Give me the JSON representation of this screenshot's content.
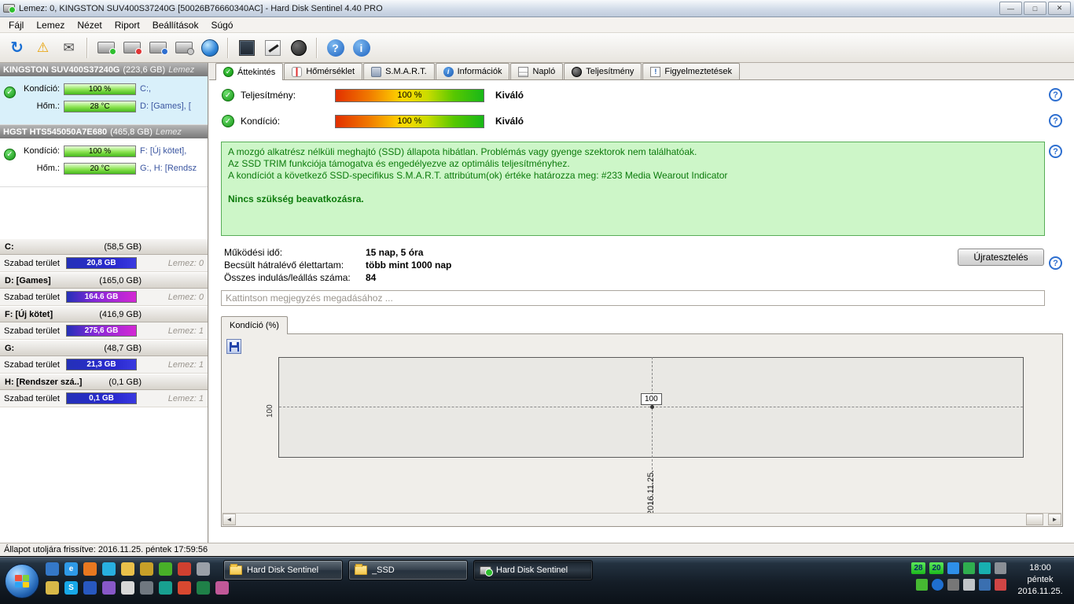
{
  "window": {
    "title": "Lemez: 0, KINGSTON SUV400S37240G [50026B76660340AC]  -  Hard Disk Sentinel 4.40 PRO",
    "controls": {
      "minimize": "—",
      "maximize": "□",
      "close": "✕"
    }
  },
  "icons": {
    "refresh": "↻",
    "warning": "⚠",
    "mail": "✉",
    "help": "?",
    "info": "i",
    "check": "✓",
    "arrow_left": "◄",
    "arrow_right": "►",
    "ie": "e",
    "skype": "S"
  },
  "menu": {
    "items": [
      "Fájl",
      "Lemez",
      "Nézet",
      "Riport",
      "Beállítások",
      "Súgó"
    ]
  },
  "sidebar": {
    "disks": [
      {
        "name": "KINGSTON SUV400S37240G",
        "size": "(223,6 GB)",
        "tail": "Lemez",
        "cond_label": "Kondíció:",
        "cond_value": "100 %",
        "temp_label": "Hőm.:",
        "temp_value": "28 °C",
        "parts1": "C:,",
        "parts2": "D: [Games], ["
      },
      {
        "name": "HGST HTS545050A7E680",
        "size": "(465,8 GB)",
        "tail": "Lemez",
        "cond_label": "Kondíció:",
        "cond_value": "100 %",
        "temp_label": "Hőm.:",
        "temp_value": "20 °C",
        "parts1": "F: [Új kötet],",
        "parts2": "G:, H: [Rendsz"
      }
    ],
    "partitions": [
      {
        "name": "C:",
        "size": "(58,5 GB)",
        "free_label": "Szabad terület",
        "free": "20,8 GB",
        "disk": "Lemez: 0",
        "fill": "100%",
        "color": "blue"
      },
      {
        "name": "D: [Games]",
        "size": "(165,0 GB)",
        "free_label": "Szabad terület",
        "free": "164.6 GB",
        "disk": "Lemez: 0",
        "fill": "100%",
        "color": "magenta"
      },
      {
        "name": "F: [Új kötet]",
        "size": "(416,9 GB)",
        "free_label": "Szabad terület",
        "free": "275,6 GB",
        "disk": "Lemez: 1",
        "fill": "100%",
        "color": "magenta"
      },
      {
        "name": "G:",
        "size": "(48,7 GB)",
        "free_label": "Szabad terület",
        "free": "21,3 GB",
        "disk": "Lemez: 1",
        "fill": "100%",
        "color": "blue"
      },
      {
        "name": "H: [Rendszer szá..]",
        "size": "(0,1 GB)",
        "free_label": "Szabad terület",
        "free": "0,1 GB",
        "disk": "Lemez: 1",
        "fill": "100%",
        "color": "blue"
      }
    ]
  },
  "tabs": [
    {
      "label": "Áttekintés"
    },
    {
      "label": "Hőmérséklet"
    },
    {
      "label": "S.M.A.R.T."
    },
    {
      "label": "Információk"
    },
    {
      "label": "Napló"
    },
    {
      "label": "Teljesítmény"
    },
    {
      "label": "Figyelmeztetések"
    }
  ],
  "overview": {
    "performance_label": "Teljesítmény:",
    "performance_value": "100 %",
    "performance_rating": "Kiváló",
    "condition_label": "Kondíció:",
    "condition_value": "100 %",
    "condition_rating": "Kiváló",
    "status_line1": "A mozgó alkatrész nélküli meghajtó (SSD) állapota hibátlan. Problémás vagy gyenge szektorok nem találhatóak.",
    "status_line2": "Az SSD TRIM funkciója támogatva és engedélyezve az optimális teljesítményhez.",
    "status_line3": "A kondíciót a következő SSD-specifikus S.M.A.R.T. attribútum(ok) értéke határozza meg:  #233 Media Wearout Indicator",
    "status_line4": "Nincs szükség beavatkozásra.",
    "stats": [
      {
        "label": "Működési idő:",
        "value": "15 nap, 5 óra"
      },
      {
        "label": "Becsült hátralévő élettartam:",
        "value": "több mint 1000 nap"
      },
      {
        "label": "Összes indulás/leállás száma:",
        "value": "84"
      }
    ],
    "retest_button": "Újratesztelés",
    "comment_placeholder": "Kattintson megjegyzés megadásához ..."
  },
  "chart": {
    "tab": "Kondíció  (%)",
    "y_tick": "100",
    "point_label": "100",
    "x_label": "2016.11.25.",
    "series": [
      {
        "name": "Kondíció (%)",
        "points": [
          {
            "x": "2016.11.25.",
            "y": 100
          }
        ]
      }
    ]
  },
  "statusbar": {
    "text": "Állapot utoljára frissítve: 2016.11.25. péntek 17:59:56"
  },
  "taskbar": {
    "buttons": [
      {
        "label": "Hard Disk Sentinel"
      },
      {
        "label": "_SSD"
      },
      {
        "label": "Hard Disk Sentinel"
      }
    ],
    "tray": {
      "temp1": "28",
      "temp2": "20"
    },
    "clock": {
      "time": "18:00",
      "day": "péntek",
      "date": "2016.11.25."
    }
  }
}
